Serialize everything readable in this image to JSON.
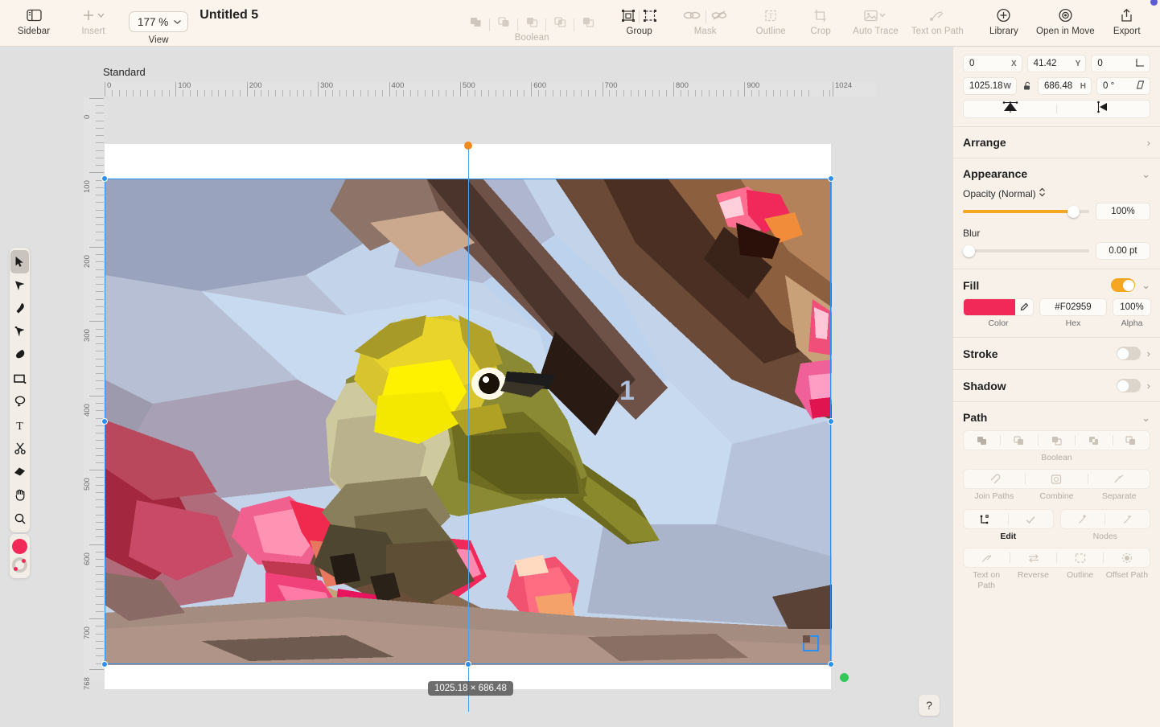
{
  "toolbar": {
    "sidebar": {
      "label": "Sidebar",
      "icon": "sidebar-icon",
      "enabled": true
    },
    "insert": {
      "label": "Insert",
      "icon": "plus-icon",
      "enabled": false
    },
    "view": {
      "label": "View",
      "zoom_value": "177 %",
      "icon": "chevron-down-icon"
    },
    "document_title": "Untitled 5",
    "boolean": {
      "label": "Boolean",
      "enabled": false,
      "icons": [
        "unite-icon",
        "subtract-icon",
        "intersect-icon",
        "exclude-icon",
        "divide-icon"
      ]
    },
    "group": {
      "label": "Group",
      "enabled": true,
      "icons": [
        "group-icon",
        "ungroup-icon"
      ]
    },
    "mask": {
      "label": "Mask",
      "enabled": false,
      "icons": [
        "mask-icon",
        "unmask-icon"
      ]
    },
    "outline": {
      "label": "Outline",
      "enabled": false,
      "icon": "outline-icon"
    },
    "crop": {
      "label": "Crop",
      "enabled": false,
      "icon": "crop-icon"
    },
    "auto_trace": {
      "label": "Auto Trace",
      "enabled": false,
      "icon": "auto-trace-icon"
    },
    "text_on_path": {
      "label": "Text on Path",
      "enabled": false,
      "icon": "text-on-path-icon"
    },
    "library": {
      "label": "Library",
      "enabled": true,
      "icon": "library-icon"
    },
    "open_in_move": {
      "label": "Open in Move",
      "enabled": true,
      "icon": "move-icon"
    },
    "export": {
      "label": "Export",
      "enabled": true,
      "icon": "export-icon",
      "badge": true
    }
  },
  "tools": {
    "items": [
      {
        "name": "selection-tool",
        "active": true
      },
      {
        "name": "node-tool",
        "active": false
      },
      {
        "name": "pen-tool",
        "active": false
      },
      {
        "name": "bezier-tool",
        "active": false
      },
      {
        "name": "brush-tool",
        "active": false
      },
      {
        "name": "rectangle-tool",
        "active": false
      },
      {
        "name": "lasso-tool",
        "active": false
      },
      {
        "name": "text-tool",
        "active": false
      },
      {
        "name": "scissors-tool",
        "active": false
      },
      {
        "name": "eraser-tool",
        "active": false
      },
      {
        "name": "hand-tool",
        "active": false
      },
      {
        "name": "zoom-tool",
        "active": false
      }
    ],
    "fill_swatch": "#F02959",
    "stroke_swatch": "none"
  },
  "canvas": {
    "artboard_label": "Standard",
    "ruler_h_ticks": [
      "0",
      "100",
      "200",
      "300",
      "400",
      "500",
      "600",
      "700",
      "800",
      "900",
      "1024"
    ],
    "ruler_v_ticks": [
      "0",
      "100",
      "200",
      "300",
      "400",
      "500",
      "600",
      "700",
      "768"
    ],
    "guide_position": "500",
    "size_tooltip": "1025.18 × 686.48",
    "help_label": "?"
  },
  "inspector": {
    "transform": {
      "x": {
        "value": "0",
        "unit": "X"
      },
      "y": {
        "value": "41.42",
        "unit": "Y"
      },
      "corner_radius": {
        "value": "0",
        "unit": "corner-radius-icon"
      },
      "width": {
        "value": "1025.18",
        "unit": "W"
      },
      "height": {
        "value": "686.48",
        "unit": "H"
      },
      "rotation": {
        "value": "0 °",
        "unit": "skew-icon"
      },
      "lock_ratio": false,
      "flip_vertical": "flip-vertical-icon",
      "flip_horizontal": "flip-horizontal-icon"
    },
    "arrange": {
      "title": "Arrange",
      "expanded": false
    },
    "appearance": {
      "title": "Appearance",
      "expanded": true,
      "opacity_label": "Opacity (Normal)",
      "opacity_value": "100%",
      "opacity_pct": 100,
      "blur_label": "Blur",
      "blur_value": "0.00 pt",
      "blur_pct": 0
    },
    "fill": {
      "title": "Fill",
      "enabled": true,
      "color": "#F02959",
      "hex": "#F02959",
      "alpha": "100%",
      "color_caption": "Color",
      "hex_caption": "Hex",
      "alpha_caption": "Alpha"
    },
    "stroke": {
      "title": "Stroke",
      "enabled": false
    },
    "shadow": {
      "title": "Shadow",
      "enabled": false
    },
    "path": {
      "title": "Path",
      "expanded": true,
      "boolean_caption": "Boolean",
      "boolean_icons": [
        "unite-icon",
        "subtract-icon",
        "intersect-icon",
        "exclude-icon",
        "divide-icon"
      ],
      "join_paths_caption": "Join Paths",
      "combine_caption": "Combine",
      "separate_caption": "Separate",
      "edit_caption": "Edit",
      "nodes_caption": "Nodes",
      "text_on_path_caption": "Text on Path",
      "reverse_caption": "Reverse",
      "outline_caption": "Outline",
      "offset_path_caption": "Offset Path"
    }
  },
  "colors": {
    "accent_orange": "#F5A623",
    "selection_blue": "#2B90F5",
    "green_handle": "#34C759",
    "toolbar_bg": "#FAF4EC",
    "inspector_bg": "#F7F1EA",
    "canvas_bg": "#E0E0E0"
  }
}
